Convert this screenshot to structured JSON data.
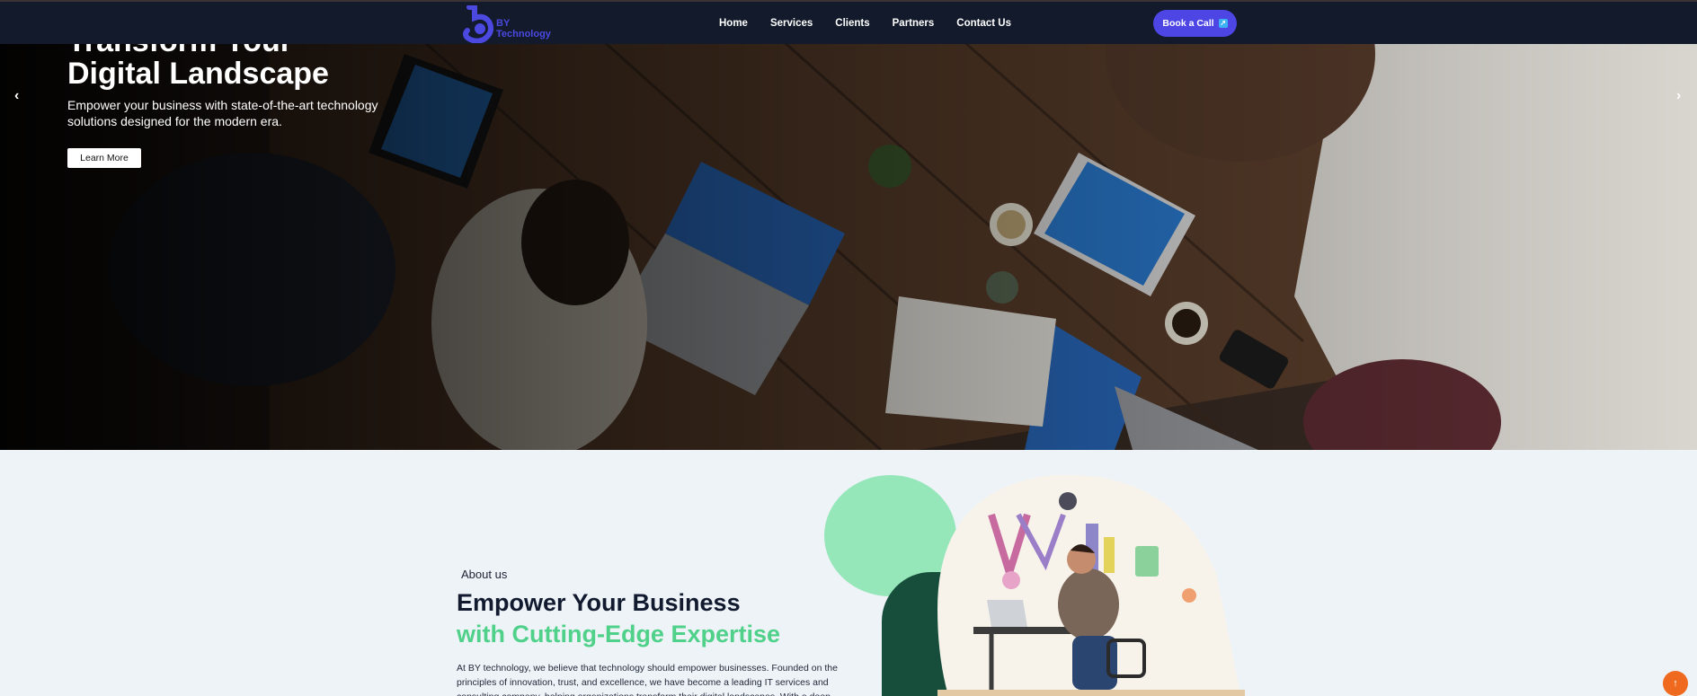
{
  "brand": {
    "name_line1": "BY",
    "name_line2": "Technology",
    "color": "#4b49e0"
  },
  "nav": {
    "items": [
      "Home",
      "Services",
      "Clients",
      "Partners",
      "Contact Us"
    ],
    "cta_label": "Book a Call",
    "cta_icon": "external-link-icon"
  },
  "hero": {
    "title_line1": "Transform Your",
    "title_line2": "Digital Landscape",
    "subtitle": "Empower your business with state-of-the-art technology solutions designed for the modern era.",
    "button_label": "Learn More",
    "prev_icon": "‹",
    "next_icon": "›"
  },
  "about": {
    "eyebrow": "About us",
    "title_line1": "Empower Your Business",
    "title_line2": "with Cutting-Edge Expertise",
    "text": "At BY technology, we believe that technology should empower businesses. Founded on the principles of innovation, trust, and excellence, we have become a leading IT services and consulting company, helping organizations transform their digital landscapes. With a deep"
  },
  "colors": {
    "nav_bg": "#121a2b",
    "accent": "#4d46e5",
    "green": "#4fd189",
    "dark_green": "#174d3b",
    "light_green": "#95e6b9"
  },
  "scroll_top_icon": "↑"
}
